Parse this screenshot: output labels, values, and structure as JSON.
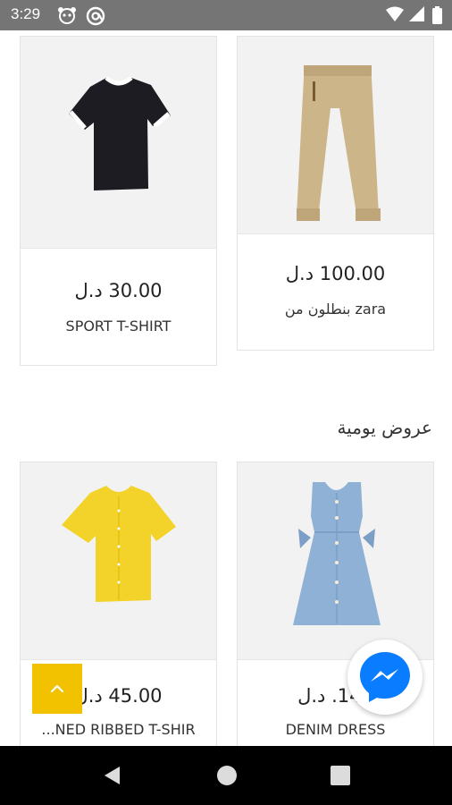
{
  "status_bar": {
    "time": "3:29",
    "icons": [
      "panda-icon",
      "at-icon",
      "wifi-icon",
      "signal-icon",
      "battery-icon"
    ]
  },
  "products_top": [
    {
      "price": "30.00 د.ل",
      "name": "SPORT T-SHIRT",
      "image": "black-tshirt-icon"
    },
    {
      "price": "100.00 د.ل",
      "name": "بنطلون من zara",
      "image": "khaki-pants-icon"
    }
  ],
  "section": {
    "title": "عروض يومية"
  },
  "products_bottom": [
    {
      "price": "45.00 د.ل",
      "name": "...NED RIBBED T-SHIR",
      "image": "yellow-shirt-icon"
    },
    {
      "price": "145. د.ل",
      "name": "DENIM DRESS",
      "image": "denim-dress-icon"
    }
  ],
  "floating": {
    "scroll_top_icon": "chevron-up-icon",
    "chat_icon": "messenger-icon"
  },
  "nav_bar": {
    "back": "back-icon",
    "home": "home-icon",
    "recents": "recents-icon"
  },
  "colors": {
    "accent": "#f2c200",
    "messenger": "#0a7cff",
    "status_bar": "#757575"
  }
}
